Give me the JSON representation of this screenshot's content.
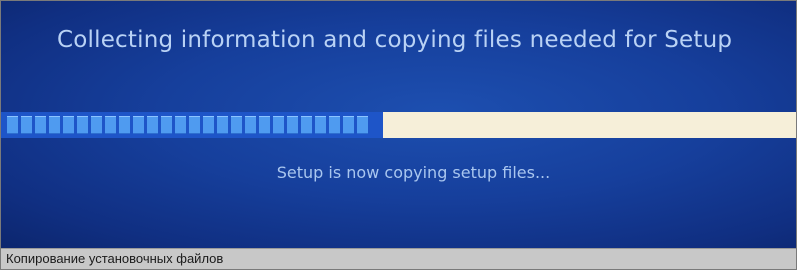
{
  "setup": {
    "heading": "Collecting information and copying files needed for Setup",
    "status": "Setup is now copying setup files...",
    "progress": 0.48
  },
  "caption": {
    "text": "Копирование установочных файлов"
  },
  "colors": {
    "background": "#163f9c",
    "progress_fill": "#1e55c8",
    "progress_block": "#4f9bf0",
    "progress_track": "#f6efd9",
    "caption_bar": "#c8c8c8"
  }
}
